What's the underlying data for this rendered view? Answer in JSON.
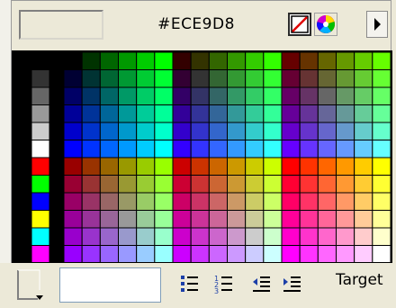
{
  "picker": {
    "hex_value": "#ECE9D8",
    "preview_color": "#ECE9D8"
  },
  "toolbar": {
    "target_label": "Target"
  },
  "icons": [
    "no-color-icon",
    "system-color-wheel-icon",
    "menu-arrow-icon",
    "fill-color-icon",
    "dropdown-arrow-icon",
    "unordered-list-icon",
    "ordered-list-icon",
    "outdent-icon",
    "indent-icon"
  ],
  "palette": {
    "gray_column": [
      "#000000",
      "#333333",
      "#666666",
      "#999999",
      "#CCCCCC",
      "#FFFFFF",
      "#FF0000",
      "#00FF00",
      "#0000FF",
      "#FFFF00",
      "#00FFFF",
      "#FF00FF"
    ],
    "levels": [
      "00",
      "33",
      "66",
      "99",
      "CC",
      "FF"
    ]
  }
}
